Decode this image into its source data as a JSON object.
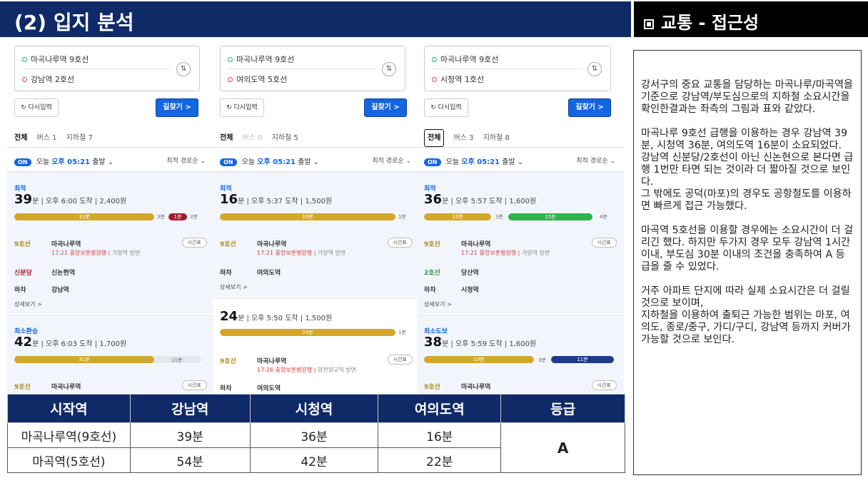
{
  "header": {
    "section_title": "(2) 입지 분석",
    "side_title": "교통 - 접근성"
  },
  "panels": [
    {
      "from": "마곡나루역 9호선",
      "to": "강남역 2호선",
      "reset": "다시입력",
      "find": "길찾기 >",
      "tabs": [
        "전체",
        "버스 1",
        "지하철 7"
      ],
      "depart": {
        "on": "ON",
        "today": "오늘",
        "time": "오후 05:21",
        "suffix": "출발",
        "sort": "최적 경로순"
      },
      "card1": {
        "label": "최적",
        "minutes": "39",
        "unit": "분",
        "arrive": "오후 6:00 도착",
        "fare": "2,400원",
        "bar_main": "31분",
        "bar_walk": "3분",
        "bar_second": "1분",
        "bar_end": "3분",
        "steps": [
          {
            "line": "9호선",
            "station": "마곡나루역",
            "sub": "17:21 중앙보훈병원행",
            "dir": "가양역 방면",
            "btn": "시간표"
          },
          {
            "line": "신분당",
            "station": "신논현역"
          },
          {
            "line": "하차",
            "station": "강남역"
          }
        ],
        "detail": "상세보기 >"
      },
      "card2": {
        "label": "최소환승",
        "minutes": "42",
        "unit": "분",
        "arrive": "오후 6:03 도착",
        "fare": "1,700원",
        "bar_main": "31분",
        "bar_end": "11분",
        "steps": [
          {
            "line": "9호선",
            "station": "마곡나루역",
            "btn": "시간표"
          }
        ]
      }
    },
    {
      "from": "마곡나루역 9호선",
      "to": "여의도역 5호선",
      "reset": "다시입력",
      "find": "길찾기 >",
      "tabs": [
        "전체",
        "버스 0",
        "지하철 5"
      ],
      "depart": {
        "on": "ON",
        "today": "오늘",
        "time": "오후 05:21",
        "suffix": "출발",
        "sort": "최적 경로순"
      },
      "card1": {
        "label": "최적",
        "minutes": "16",
        "unit": "분",
        "arrive": "오후 5:37 도착",
        "fare": "1,500원",
        "bar_main": "16분",
        "bar_end": "1분",
        "steps": [
          {
            "line": "9호선",
            "station": "마곡나루역",
            "sub": "17:21 중앙보훈병원행",
            "dir": "가양역 방면",
            "btn": "시간표"
          },
          {
            "line": "하차",
            "station": "여의도역"
          }
        ],
        "detail": "상세보기 >"
      },
      "card2": {
        "minutes": "24",
        "unit": "분",
        "arrive": "오후 5:50 도착",
        "fare": "1,500원",
        "bar_main": "24분",
        "bar_end": "1분",
        "steps": [
          {
            "line": "9호선",
            "station": "마곡나루역",
            "sub": "17:26 중앙보훈병원행",
            "dir": "양천향교역 방면",
            "btn": "시간표"
          },
          {
            "line": "하차",
            "station": "여의도역"
          }
        ]
      }
    },
    {
      "from": "마곡나루역 9호선",
      "to": "시청역 1호선",
      "reset": "다시입력",
      "find": "길찾기 >",
      "tabs": [
        "전체",
        "버스 3",
        "지하철 8"
      ],
      "depart": {
        "on": "ON",
        "today": "오늘",
        "time": "오후 05:21",
        "suffix": "출발",
        "sort": "최적 경로순"
      },
      "card1": {
        "label": "최적",
        "minutes": "36",
        "unit": "분",
        "arrive": "오후 5:57 도착",
        "fare": "1,600원",
        "bar_main": "12분",
        "bar_walk": "3분",
        "bar_second": "15분",
        "bar_end": "4분",
        "steps": [
          {
            "line": "9호선",
            "station": "마곡나루역",
            "sub": "17:21 중앙보훈병원행",
            "dir": "가양역 방면",
            "btn": "시간표"
          },
          {
            "line": "2호선",
            "station": "당산역"
          },
          {
            "line": "하차",
            "station": "시청역"
          }
        ],
        "detail": "상세보기 >"
      },
      "card2": {
        "label": "최소도보",
        "minutes": "38",
        "unit": "분",
        "arrive": "오후 5:59 도착",
        "fare": "1,600원",
        "bar_main": "19분",
        "bar_walk": "3분",
        "bar_second": "11분",
        "steps": [
          {
            "line": "9호선",
            "station": "마곡나루역",
            "btn": "시간표"
          }
        ]
      }
    }
  ],
  "table": {
    "headers": [
      "시작역",
      "강남역",
      "시청역",
      "여의도역",
      "등급"
    ],
    "rows": [
      [
        "마곡나루역(9호선)",
        "39분",
        "36분",
        "16분"
      ],
      [
        "마곡역(5호선)",
        "54분",
        "42분",
        "22분"
      ]
    ],
    "grade": "A"
  },
  "text": {
    "p1": "강서구의 중요 교통을 담당하는 마곡나루/마곡역을 기준으로 강남역/부도심으로의 지하철 소요시간을 확인한결과는 좌측의 그림과 표와 같았다.",
    "p2": "마곡나루 9호선 급행을 이용하는 경우 강남역 39분, 시청역 36분, 여의도역 16분이 소요되었다.\n강남역 신분당/2호선이 아닌 신논현으로 본다면 급행 1번만 타면 되는 것이라 더 짧아질 것으로 보인다.\n그 밖에도 공덕(마포)의 경우도 공항철도를 이용하면 빠르게 접근 가능했다.",
    "p3": "마곡역 5호선을 이용할 경우에는 소요시간이 더 걸리긴 했다. 하지만 두가지 경우 모두 강남역 1시간 이내, 부도심 30분 이내의 조건을 충족하여 A 등급을 줄 수 있었다.",
    "p4": "거주 아파트 단지에 따라 실제 소요시간은 더 걸릴 것으로 보이며,\n지하철을 이용하여 출퇴근 가능한 범위는 마포, 여의도, 종로/중구, 가디/구디, 강남역 등까지 커버가 가능할 것으로 보인다."
  }
}
